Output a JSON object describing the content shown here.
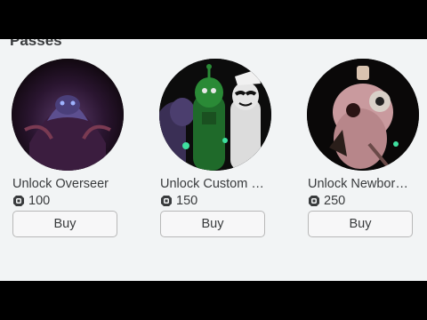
{
  "section": {
    "title": "Passes"
  },
  "passes": [
    {
      "name": "Unlock Overseer",
      "price": "100",
      "buy_label": "Buy",
      "image": "overseer-thumbnail"
    },
    {
      "name": "Unlock Custom S...",
      "price": "150",
      "buy_label": "Buy",
      "image": "custom-slendytubbies-thumbnail"
    },
    {
      "name": "Unlock Newborn ...",
      "price": "250",
      "buy_label": "Buy",
      "image": "newborn-thumbnail"
    }
  ],
  "icons": {
    "currency": "robux-icon"
  },
  "colors": {
    "panel_bg": "#f2f4f5",
    "text": "#393b3d",
    "button_border": "#b8b8b8",
    "frame": "#000000"
  }
}
